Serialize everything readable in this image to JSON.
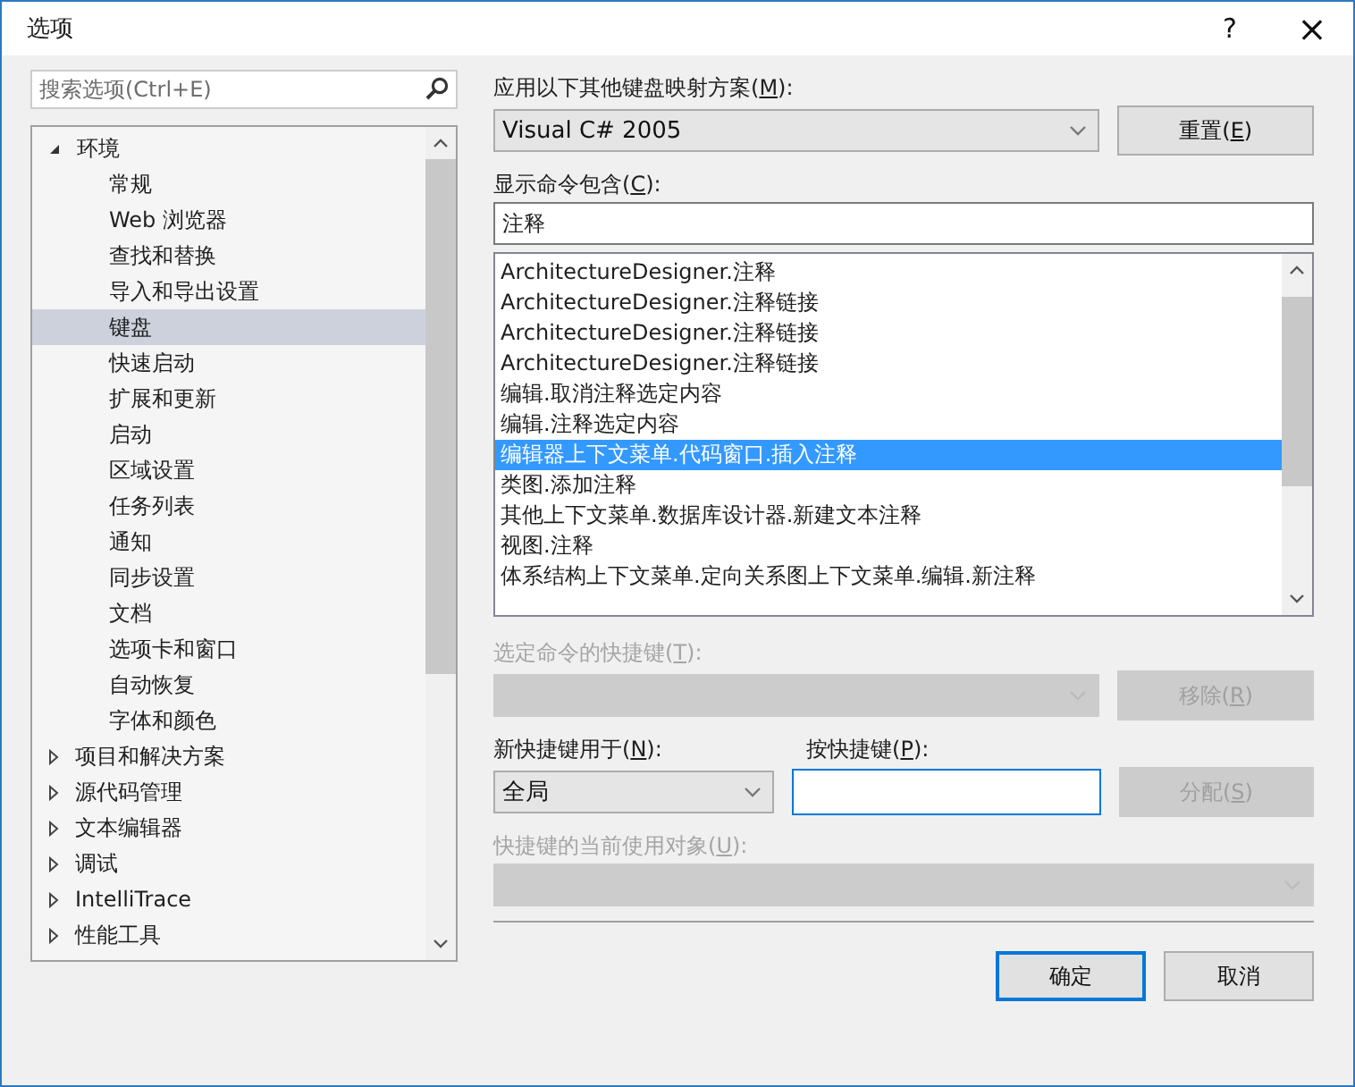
{
  "window": {
    "title": "选项",
    "help": "?",
    "close": "×"
  },
  "search": {
    "placeholder": "搜索选项(Ctrl+E)"
  },
  "tree": [
    {
      "label": "环境",
      "expanded": true,
      "selected": false,
      "children": [
        {
          "label": "常规",
          "selected": false
        },
        {
          "label": "Web 浏览器",
          "selected": false
        },
        {
          "label": "查找和替换",
          "selected": false
        },
        {
          "label": "导入和导出设置",
          "selected": false
        },
        {
          "label": "键盘",
          "selected": true
        },
        {
          "label": "快速启动",
          "selected": false
        },
        {
          "label": "扩展和更新",
          "selected": false
        },
        {
          "label": "启动",
          "selected": false
        },
        {
          "label": "区域设置",
          "selected": false
        },
        {
          "label": "任务列表",
          "selected": false
        },
        {
          "label": "通知",
          "selected": false
        },
        {
          "label": "同步设置",
          "selected": false
        },
        {
          "label": "文档",
          "selected": false
        },
        {
          "label": "选项卡和窗口",
          "selected": false
        },
        {
          "label": "自动恢复",
          "selected": false
        },
        {
          "label": "字体和颜色",
          "selected": false
        }
      ]
    },
    {
      "label": "项目和解决方案",
      "expanded": false,
      "selected": false
    },
    {
      "label": "源代码管理",
      "expanded": false,
      "selected": false
    },
    {
      "label": "文本编辑器",
      "expanded": false,
      "selected": false
    },
    {
      "label": "调试",
      "expanded": false,
      "selected": false
    },
    {
      "label": "IntelliTrace",
      "expanded": false,
      "selected": false
    },
    {
      "label": "性能工具",
      "expanded": false,
      "selected": false
    }
  ],
  "mapping": {
    "label": {
      "before": "应用以下其他键盘映射方案(",
      "key": "M",
      "after": "):"
    },
    "value": "Visual C# 2005",
    "disabled": false
  },
  "reset_button": {
    "before": "重置(",
    "key": "E",
    "after": ")",
    "disabled": false
  },
  "filter": {
    "label": {
      "before": "显示命令包含(",
      "key": "C",
      "after": "):"
    },
    "value": "注释"
  },
  "commands": [
    {
      "label": "ArchitectureDesigner.注释",
      "selected": false
    },
    {
      "label": "ArchitectureDesigner.注释链接",
      "selected": false
    },
    {
      "label": "ArchitectureDesigner.注释链接",
      "selected": false
    },
    {
      "label": "ArchitectureDesigner.注释链接",
      "selected": false
    },
    {
      "label": "编辑.取消注释选定内容",
      "selected": false
    },
    {
      "label": "编辑.注释选定内容",
      "selected": false
    },
    {
      "label": "编辑器上下文菜单.代码窗口.插入注释",
      "selected": true
    },
    {
      "label": "类图.添加注释",
      "selected": false
    },
    {
      "label": "其他上下文菜单.数据库设计器.新建文本注释",
      "selected": false
    },
    {
      "label": "视图.注释",
      "selected": false
    },
    {
      "label": "体系结构上下文菜单.定向关系图上下文菜单.编辑.新注释",
      "selected": false
    }
  ],
  "shortcuts": {
    "label": {
      "before": "选定命令的快捷键(",
      "key": "T",
      "after": "):"
    },
    "disabled": true
  },
  "remove_button": {
    "before": "移除(",
    "key": "R",
    "after": ")",
    "disabled": true
  },
  "scope": {
    "label": {
      "before": "新快捷键用于(",
      "key": "N",
      "after": "):"
    },
    "value": "全局",
    "disabled": false
  },
  "press": {
    "label": {
      "before": "按快捷键(",
      "key": "P",
      "after": "):"
    }
  },
  "assign_button": {
    "before": "分配(",
    "key": "S",
    "after": ")",
    "disabled": true
  },
  "current_use": {
    "label": {
      "before": "快捷键的当前使用对象(",
      "key": "U",
      "after": "):"
    },
    "disabled": true
  },
  "footer_buttons": [
    {
      "label": "确定",
      "default": true,
      "disabled": false
    },
    {
      "label": "取消",
      "default": false,
      "disabled": false
    }
  ]
}
